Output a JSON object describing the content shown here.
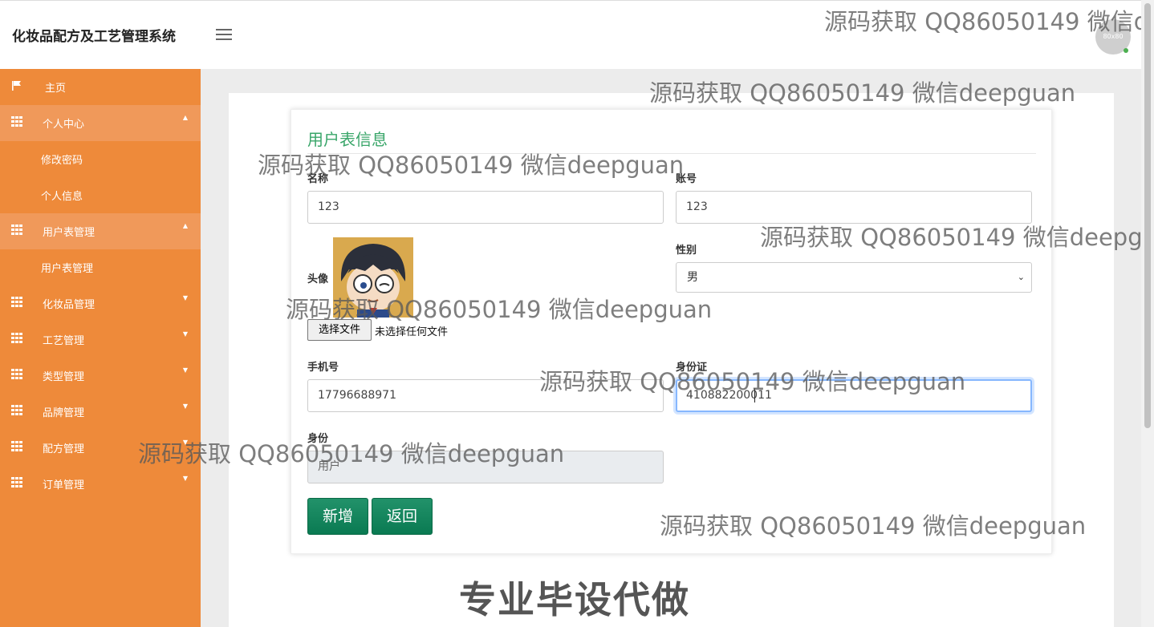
{
  "header": {
    "app_title": "化妆品配方及工艺管理系统",
    "avatar_text": "80x80"
  },
  "sidebar": {
    "items": [
      {
        "label": "主页",
        "icon": "flag-icon"
      },
      {
        "label": "个人中心",
        "icon": "grid-icon",
        "expanded": true
      },
      {
        "label": "修改密码"
      },
      {
        "label": "个人信息"
      },
      {
        "label": "用户表管理",
        "icon": "grid-icon",
        "expanded": true
      },
      {
        "label": "用户表管理"
      },
      {
        "label": "化妆品管理",
        "icon": "grid-icon"
      },
      {
        "label": "工艺管理",
        "icon": "grid-icon"
      },
      {
        "label": "类型管理",
        "icon": "grid-icon"
      },
      {
        "label": "品牌管理",
        "icon": "grid-icon"
      },
      {
        "label": "配方管理",
        "icon": "grid-icon"
      },
      {
        "label": "订单管理",
        "icon": "grid-icon"
      }
    ]
  },
  "form": {
    "title": "用户表信息",
    "name_label": "名称",
    "name_value": "123",
    "account_label": "账号",
    "account_value": "123",
    "avatar_label": "头像",
    "gender_label": "性别",
    "gender_value": "男",
    "file_button": "选择文件",
    "file_note": "未选择任何文件",
    "phone_label": "手机号",
    "phone_value": "17796688971",
    "idcard_label": "身份证",
    "idcard_value": "410882200011",
    "role_label": "身份",
    "role_value": "用户",
    "add_button": "新增",
    "back_button": "返回"
  },
  "watermark": "源码获取 QQ86050149 微信deepguan",
  "banner": "专业毕设代做",
  "colors": {
    "sidebar": "#ee8a3a",
    "accent_title": "#3aa66a",
    "button": "#0a7a52"
  }
}
